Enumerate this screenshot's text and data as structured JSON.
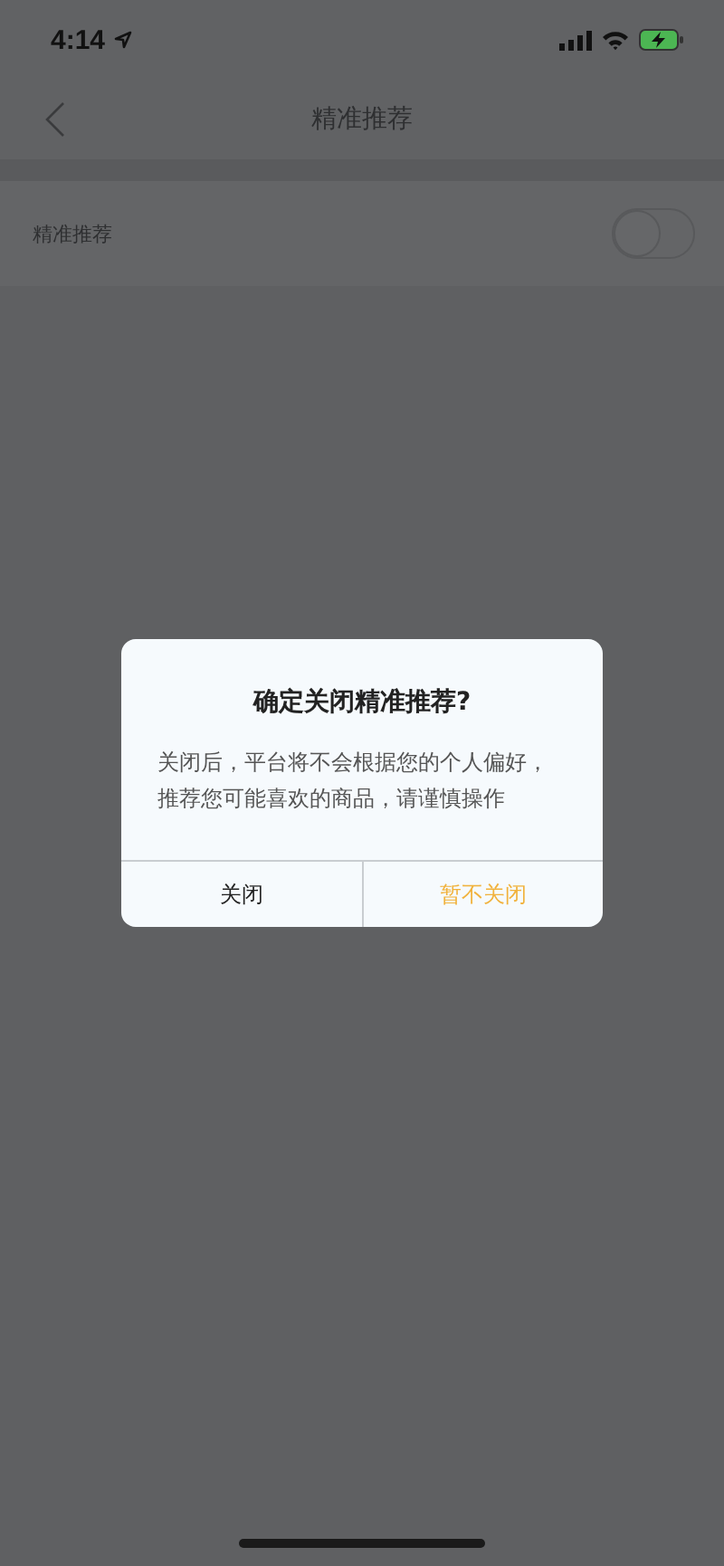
{
  "status_bar": {
    "time": "4:14"
  },
  "nav": {
    "title": "精准推荐"
  },
  "settings": [
    {
      "label": "精准推荐",
      "on": false
    }
  ],
  "dialog": {
    "title": "确定关闭精准推荐?",
    "message": "关闭后，平台将不会根据您的个人偏好，推荐您可能喜欢的商品，请谨慎操作",
    "buttons": [
      {
        "label": "关闭",
        "kind": "default"
      },
      {
        "label": "暂不关闭",
        "kind": "primary"
      }
    ]
  }
}
